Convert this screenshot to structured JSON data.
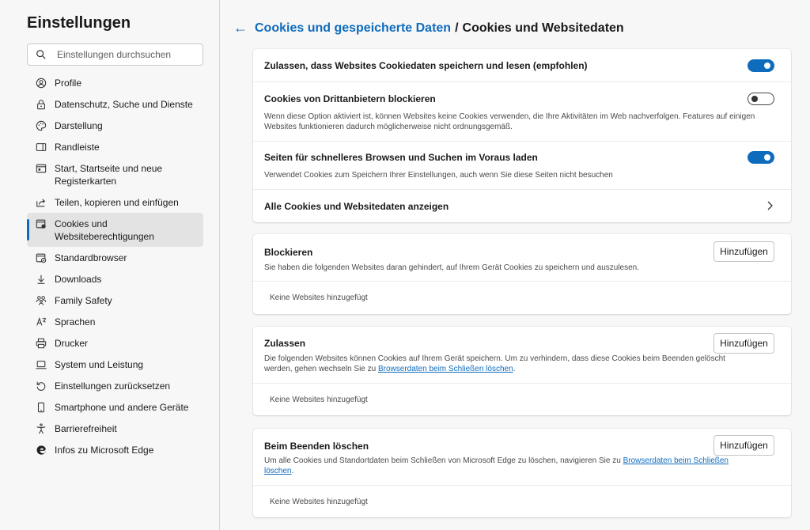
{
  "sidebar": {
    "title": "Einstellungen",
    "search_placeholder": "Einstellungen durchsuchen",
    "items": [
      {
        "label": "Profile",
        "icon": "profile-icon"
      },
      {
        "label": "Datenschutz, Suche und Dienste",
        "icon": "lock-icon"
      },
      {
        "label": "Darstellung",
        "icon": "palette-icon"
      },
      {
        "label": "Randleiste",
        "icon": "sidebar-icon"
      },
      {
        "label": "Start, Startseite und neue Registerkarten",
        "icon": "home-tab-icon"
      },
      {
        "label": "Teilen, kopieren und einfügen",
        "icon": "share-icon"
      },
      {
        "label": "Cookies und Websiteberechtigungen",
        "icon": "cookie-permissions-icon"
      },
      {
        "label": "Standardbrowser",
        "icon": "default-browser-icon"
      },
      {
        "label": "Downloads",
        "icon": "download-icon"
      },
      {
        "label": "Family Safety",
        "icon": "family-icon"
      },
      {
        "label": "Sprachen",
        "icon": "language-icon"
      },
      {
        "label": "Drucker",
        "icon": "printer-icon"
      },
      {
        "label": "System und Leistung",
        "icon": "laptop-icon"
      },
      {
        "label": "Einstellungen zurücksetzen",
        "icon": "reset-icon"
      },
      {
        "label": "Smartphone und andere Geräte",
        "icon": "phone-icon"
      },
      {
        "label": "Barrierefreiheit",
        "icon": "accessibility-icon"
      },
      {
        "label": "Infos zu Microsoft Edge",
        "icon": "edge-logo-icon"
      }
    ],
    "active_index": 6
  },
  "breadcrumb": {
    "parent": "Cookies und gespeicherte Daten",
    "separator": "/",
    "current": "Cookies und Websitedaten"
  },
  "settings": {
    "allow_cookies": {
      "title": "Zulassen, dass Websites Cookiedaten speichern und lesen (empfohlen)",
      "enabled": true
    },
    "block_third_party": {
      "title": "Cookies von Drittanbietern blockieren",
      "desc": "Wenn diese Option aktiviert ist, können Websites keine Cookies verwenden, die Ihre Aktivitäten im Web nachverfolgen. Features auf einigen Websites funktionieren dadurch möglicherweise nicht ordnungsgemäß.",
      "enabled": false
    },
    "preload": {
      "title": "Seiten für schnelleres Browsen und Suchen im Voraus laden",
      "desc": "Verwendet Cookies zum Speichern Ihrer Einstellungen, auch wenn Sie diese Seiten nicht besuchen",
      "enabled": true
    },
    "see_all": {
      "title": "Alle Cookies und Websitedaten anzeigen"
    }
  },
  "sections": {
    "block": {
      "title": "Blockieren",
      "desc": "Sie haben die folgenden Websites daran gehindert, auf Ihrem Gerät Cookies zu speichern und auszulesen.",
      "button": "Hinzufügen",
      "empty": "Keine Websites hinzugefügt"
    },
    "allow": {
      "title": "Zulassen",
      "desc_before": "Die folgenden Websites können Cookies auf Ihrem Gerät speichern. Um zu verhindern, dass diese Cookies beim Beenden gelöscht werden, gehen wechseln Sie zu ",
      "desc_link": "Browserdaten beim Schließen löschen",
      "desc_after": ".",
      "button": "Hinzufügen",
      "empty": "Keine Websites hinzugefügt"
    },
    "clear_on_exit": {
      "title": "Beim Beenden löschen",
      "desc_before": "Um alle Cookies und Standortdaten beim Schließen von Microsoft Edge zu löschen, navigieren Sie zu ",
      "desc_link": "Browserdaten beim Schließen löschen",
      "desc_after": ".",
      "button": "Hinzufügen",
      "empty": "Keine Websites hinzugefügt"
    }
  },
  "colors": {
    "accent": "#0f6cbd",
    "background": "#f7f7f7",
    "card": "#ffffff"
  }
}
